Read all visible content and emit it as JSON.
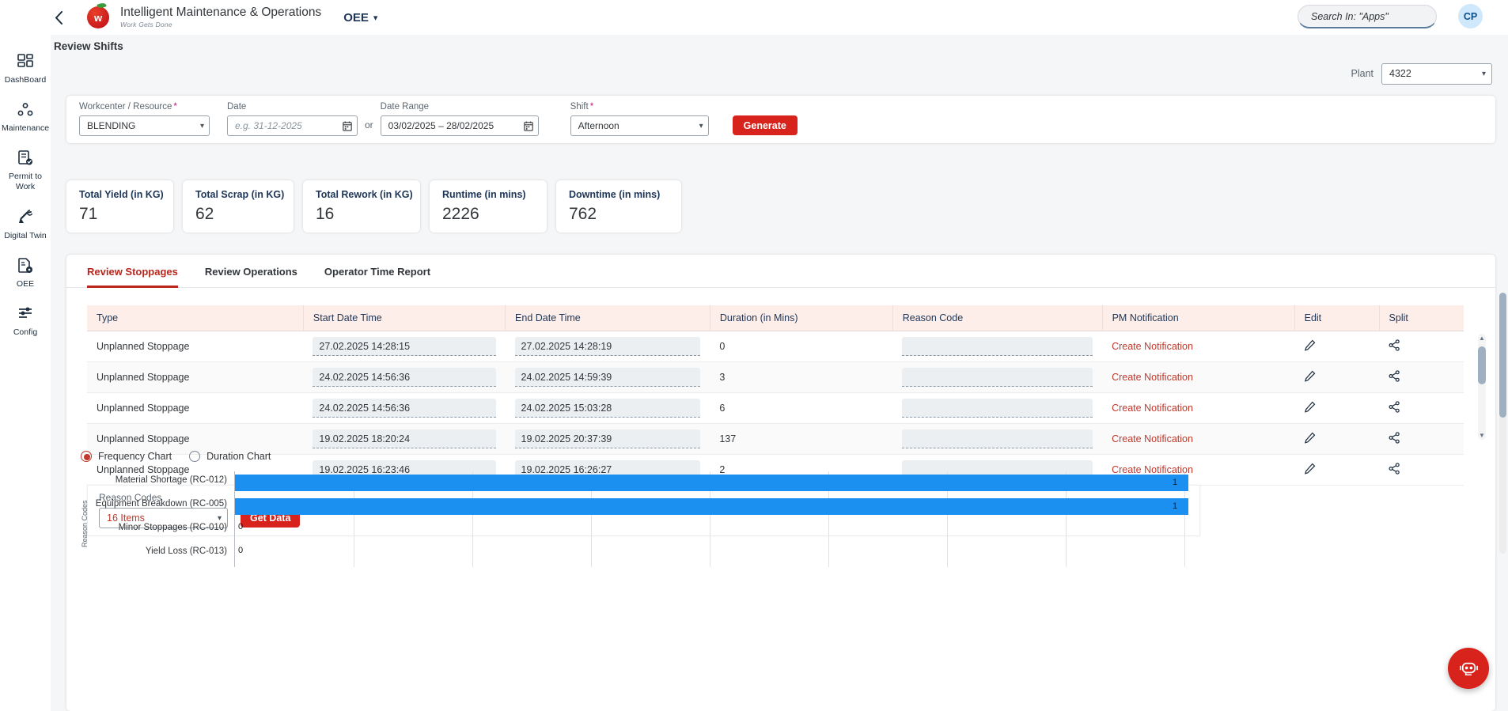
{
  "topbar": {
    "back_icon": "chevron-left-icon",
    "brand_letter": "w",
    "brand_title": "Intelligent Maintenance & Operations",
    "brand_subtitle": "Work Gets Done",
    "app_name": "OEE",
    "search_placeholder": "Search In: \"Apps\"",
    "search_value": "",
    "avatar_initials": "CP"
  },
  "sidebar": {
    "items": [
      {
        "label": "DashBoard",
        "icon": "grid-dashboard-icon"
      },
      {
        "label": "Maintenance",
        "icon": "nodes-maintenance-icon"
      },
      {
        "label": "Permit to Work",
        "icon": "document-check-icon"
      },
      {
        "label": "Digital Twin",
        "icon": "robot-arm-icon"
      },
      {
        "label": "OEE",
        "icon": "document-gear-icon"
      },
      {
        "label": "Config",
        "icon": "settings-sliders-icon"
      }
    ]
  },
  "page": {
    "title": "Review Shifts",
    "plant_label": "Plant",
    "plant_value": "4322"
  },
  "filters": {
    "workcenter": {
      "label": "Workcenter / Resource",
      "required": true,
      "value": "BLENDING"
    },
    "date": {
      "label": "Date",
      "required": false,
      "placeholder": "e.g. 31-12-2025",
      "value": ""
    },
    "or_text": "or",
    "date_range": {
      "label": "Date Range",
      "required": false,
      "value": "03/02/2025 – 28/02/2025"
    },
    "shift": {
      "label": "Shift",
      "required": true,
      "value": "Afternoon"
    },
    "generate_label": "Generate"
  },
  "kpis": [
    {
      "title": "Total Yield (in KG)",
      "value": "71"
    },
    {
      "title": "Total Scrap (in KG)",
      "value": "62"
    },
    {
      "title": "Total Rework (in KG)",
      "value": "16"
    },
    {
      "title": "Runtime (in mins)",
      "value": "2226"
    },
    {
      "title": "Downtime (in mins)",
      "value": "762"
    }
  ],
  "tabs": [
    {
      "label": "Review Stoppages",
      "active": true
    },
    {
      "label": "Review Operations",
      "active": false
    },
    {
      "label": "Operator Time Report",
      "active": false
    }
  ],
  "table": {
    "columns": [
      "Type",
      "Start Date Time",
      "End Date Time",
      "Duration (in Mins)",
      "Reason Code",
      "PM Notification",
      "Edit",
      "Split"
    ],
    "rows": [
      {
        "type": "Unplanned Stoppage",
        "start": "27.02.2025 14:28:15",
        "end": "27.02.2025 14:28:19",
        "duration": "0",
        "reason": "",
        "pm": "Create Notification",
        "edit_icon": "pencil-icon",
        "split_icon": "share-split-icon"
      },
      {
        "type": "Unplanned Stoppage",
        "start": "24.02.2025 14:56:36",
        "end": "24.02.2025 14:59:39",
        "duration": "3",
        "reason": "",
        "pm": "Create Notification",
        "edit_icon": "pencil-icon",
        "split_icon": "share-split-icon"
      },
      {
        "type": "Unplanned Stoppage",
        "start": "24.02.2025 14:56:36",
        "end": "24.02.2025 15:03:28",
        "duration": "6",
        "reason": "",
        "pm": "Create Notification",
        "edit_icon": "pencil-icon",
        "split_icon": "share-split-icon"
      },
      {
        "type": "Unplanned Stoppage",
        "start": "19.02.2025 18:20:24",
        "end": "19.02.2025 20:37:39",
        "duration": "137",
        "reason": "",
        "pm": "Create Notification",
        "edit_icon": "pencil-icon",
        "split_icon": "share-split-icon"
      },
      {
        "type": "Unplanned Stoppage",
        "start": "19.02.2025 16:23:46",
        "end": "19.02.2025 16:26:27",
        "duration": "2",
        "reason": "",
        "pm": "Create Notification",
        "edit_icon": "pencil-icon",
        "split_icon": "share-split-icon"
      }
    ]
  },
  "reason_codes": {
    "label": "Reason Codes",
    "selected": "16 Items",
    "get_data_label": "Get Data"
  },
  "chart_mode": {
    "options": [
      {
        "label": "Frequency Chart",
        "selected": true
      },
      {
        "label": "Duration Chart",
        "selected": false
      }
    ]
  },
  "chart_data": {
    "type": "bar",
    "orientation": "horizontal",
    "title": "",
    "xlabel": "",
    "ylabel": "Reason Codes",
    "categories": [
      "Material Shortage (RC-012)",
      "Equipment Breakdown (RC-005)",
      "Minor Stoppages (RC-010)",
      "Yield Loss (RC-013)"
    ],
    "values": [
      1,
      1,
      0,
      0
    ],
    "data_labels": [
      "1",
      "1",
      "0",
      "0"
    ],
    "xlim": [
      0,
      1
    ],
    "grid": true,
    "legend": false,
    "bar_color": "#1b90f0"
  },
  "fab": {
    "icon": "chat-bot-icon"
  }
}
